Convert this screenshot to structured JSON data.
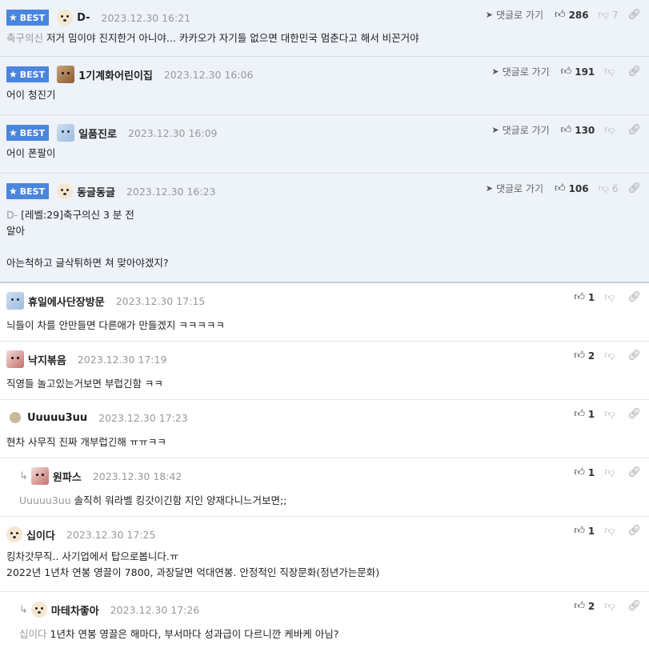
{
  "best_label": "BEST",
  "reply_label": "댓글로 가기",
  "comments": [
    {
      "nick": "D-",
      "date": "2023.12.30 16:21",
      "up": "286",
      "down": "7",
      "ref": "축구의신",
      "text": "저거 밈이야 진지한거 아니야... 카카오가 자기들 없으면 대한민국 멈춘다고 해서 비꼰거야"
    },
    {
      "nick": "1기계화어린이집",
      "date": "2023.12.30 16:06",
      "up": "191",
      "down": "",
      "ref": "",
      "text": "어이 청진기"
    },
    {
      "nick": "일품진로",
      "date": "2023.12.30 16:09",
      "up": "130",
      "down": "",
      "ref": "",
      "text": "어이 폰팔이"
    },
    {
      "nick": "동글동글",
      "date": "2023.12.30 16:23",
      "up": "106",
      "down": "6",
      "ref": "D-",
      "line1": "[레벨:29]축구의신 3 분 전",
      "line2": "알아",
      "line3": "아는척하고 글삭튀하면 쳐 맞아야겠지?"
    },
    {
      "nick": "휴일에사단장방문",
      "date": "2023.12.30 17:15",
      "up": "1",
      "text": "늬들이 차를 안만들면 다른애가 만들겠지 ㅋㅋㅋㅋㅋ"
    },
    {
      "nick": "낙지볶음",
      "date": "2023.12.30 17:19",
      "up": "2",
      "text": "직영들 놀고있는거보면 부럽긴함 ㅋㅋ"
    },
    {
      "nick": "Uuuuu3uu",
      "date": "2023.12.30 17:23",
      "up": "1",
      "text": "현차 사무직 진짜 개부럽긴해 ㅠㅠㅋㅋ"
    },
    {
      "nick": "원파스",
      "date": "2023.12.30 18:42",
      "up": "1",
      "ref": "Uuuuu3uu",
      "text": "솔직히 워라벨 킹갓이긴함 지인 양재다니느거보면;;"
    },
    {
      "nick": "십이다",
      "date": "2023.12.30 17:25",
      "up": "1",
      "line1": "킹차갓무직.. 사기업에서 탑으로봅니다.ㅠ",
      "line2": "2022년 1년차 연봉 영끌이 7800, 과장달면 억대연봉. 안정적인 직장문화(정년가는문화)"
    },
    {
      "nick": "마테차좋아",
      "date": "2023.12.30 17:26",
      "up": "2",
      "ref": "십이다",
      "text": "1년차 연봉 영끌은 해마다, 부서마다 성과급이 다르니깐 케바케 아님?"
    }
  ]
}
